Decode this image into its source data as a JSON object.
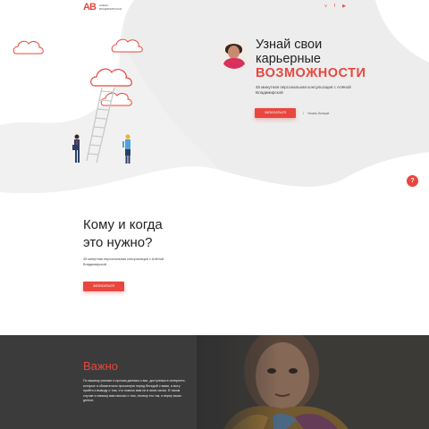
{
  "header": {
    "logo_mark": "AB",
    "logo_line1": "Алёна",
    "logo_line2": "Владимирская",
    "social": [
      {
        "icon": "vk-icon",
        "glyph": "v"
      },
      {
        "icon": "facebook-icon",
        "glyph": "f"
      },
      {
        "icon": "youtube-icon",
        "glyph": "▶"
      }
    ]
  },
  "hero": {
    "title_line1": "Узнай свои",
    "title_line2": "карьерные",
    "title_accent": "ВОЗМОЖНОСТИ",
    "subtitle": "45 минутная персональная консультация с Алёной Владимирской",
    "button": "Записаться",
    "more": "Узнать больше",
    "help": "?"
  },
  "who": {
    "title_line1": "Кому и когда",
    "title_line2": "это нужно?",
    "subtitle": "45 минутная персональная консультация с Алёной Владимирской",
    "button": "Записаться"
  },
  "important": {
    "title": "Важно",
    "text": "По вашему резюме и прочим данным о вас, доступным в интернете, которые я обязательно просмотрю перед беседой с вами, я могу прийти к выводу о том, что помочь вам не в моих силах. В таком случае я напишу вам письмо о том, почему это так, и верну ваши деньги."
  },
  "colors": {
    "accent": "#e8473f",
    "dark": "#3b3b3b"
  }
}
